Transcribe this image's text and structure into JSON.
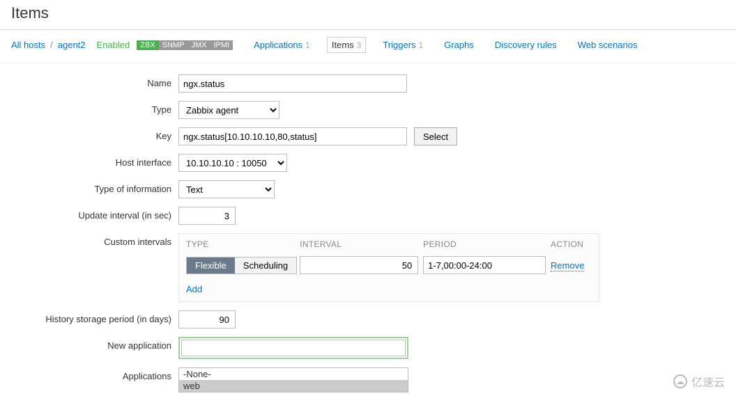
{
  "page_title": "Items",
  "breadcrumb": {
    "all": "All hosts",
    "host": "agent2"
  },
  "status_enabled": "Enabled",
  "badges": [
    "ZBX",
    "SNMP",
    "JMX",
    "IPMI"
  ],
  "tabs": [
    {
      "label": "Applications",
      "count": "1",
      "active": false
    },
    {
      "label": "Items",
      "count": "3",
      "active": true
    },
    {
      "label": "Triggers",
      "count": "1",
      "active": false
    },
    {
      "label": "Graphs",
      "count": "",
      "active": false
    },
    {
      "label": "Discovery rules",
      "count": "",
      "active": false
    },
    {
      "label": "Web scenarios",
      "count": "",
      "active": false
    }
  ],
  "form": {
    "name_label": "Name",
    "name_value": "ngx.status",
    "type_label": "Type",
    "type_value": "Zabbix agent",
    "key_label": "Key",
    "key_value": "ngx.status[10.10.10.10,80,status]",
    "key_select": "Select",
    "host_if_label": "Host interface",
    "host_if_value": "10.10.10.10 : 10050",
    "info_label": "Type of information",
    "info_value": "Text",
    "upd_label": "Update interval (in sec)",
    "upd_value": "3",
    "ci_label": "Custom intervals",
    "ci_head_type": "TYPE",
    "ci_head_interval": "INTERVAL",
    "ci_head_period": "PERIOD",
    "ci_head_action": "ACTION",
    "ci_flexible": "Flexible",
    "ci_scheduling": "Scheduling",
    "ci_interval_value": "50",
    "ci_period_value": "1-7,00:00-24:00",
    "ci_remove": "Remove",
    "ci_add": "Add",
    "hist_label": "History storage period (in days)",
    "hist_value": "90",
    "newapp_label": "New application",
    "newapp_value": "",
    "apps_label": "Applications",
    "apps_options": [
      "-None-",
      "web"
    ]
  },
  "watermark": "亿速云"
}
